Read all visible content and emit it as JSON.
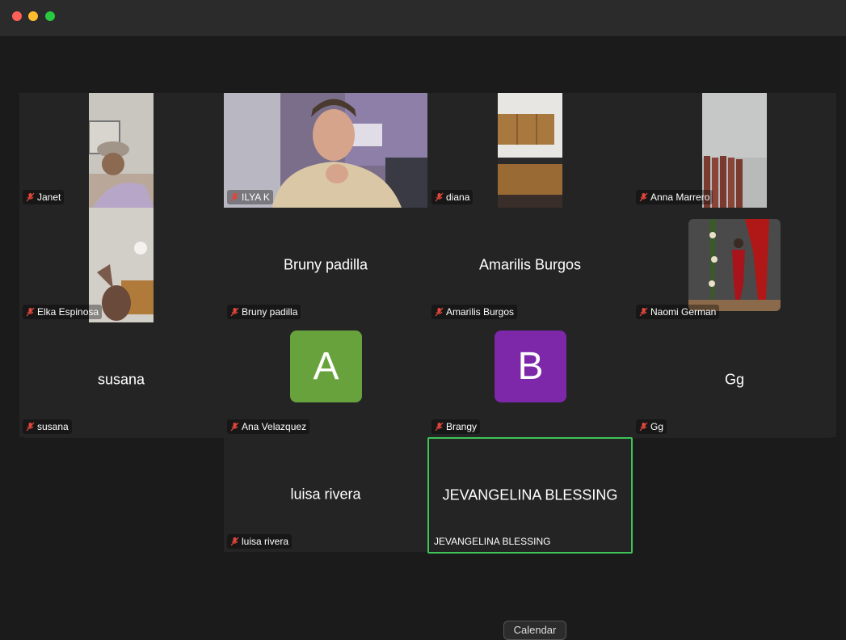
{
  "window": {
    "title": "",
    "controls": [
      "close",
      "minimize",
      "maximize"
    ]
  },
  "participants": [
    {
      "name": "Janet",
      "muted": true,
      "video": true
    },
    {
      "name": "ILYA K",
      "muted": true,
      "video": true
    },
    {
      "name": "diana",
      "muted": true,
      "video": true
    },
    {
      "name": "Anna Marrero",
      "muted": true,
      "video": true
    },
    {
      "name": "Elka Espinosa",
      "muted": true,
      "video": true
    },
    {
      "name": "Bruny padilla",
      "muted": true,
      "video": false
    },
    {
      "name": "Amarilis Burgos",
      "muted": true,
      "video": false
    },
    {
      "name": "Naomi German",
      "muted": true,
      "video": true
    },
    {
      "name": "susana",
      "muted": true,
      "video": false
    },
    {
      "name": "Ana Velazquez",
      "muted": true,
      "video": false,
      "avatar_letter": "A",
      "avatar_color": "#67a23c"
    },
    {
      "name": "Brangy",
      "muted": true,
      "video": false,
      "avatar_letter": "B",
      "avatar_color": "#7c28a8"
    },
    {
      "name": "Gg",
      "muted": true,
      "video": false
    },
    {
      "name": "luisa rivera",
      "muted": true,
      "video": false
    },
    {
      "name": "JEVANGELINA BLESSING",
      "muted": false,
      "video": false,
      "active_speaker": true
    }
  ],
  "tooltip": {
    "text": "Calendar"
  },
  "colors": {
    "active_speaker_border": "#3fc45a",
    "mute_icon": "#e0463a",
    "tile_bg": "#242424"
  }
}
